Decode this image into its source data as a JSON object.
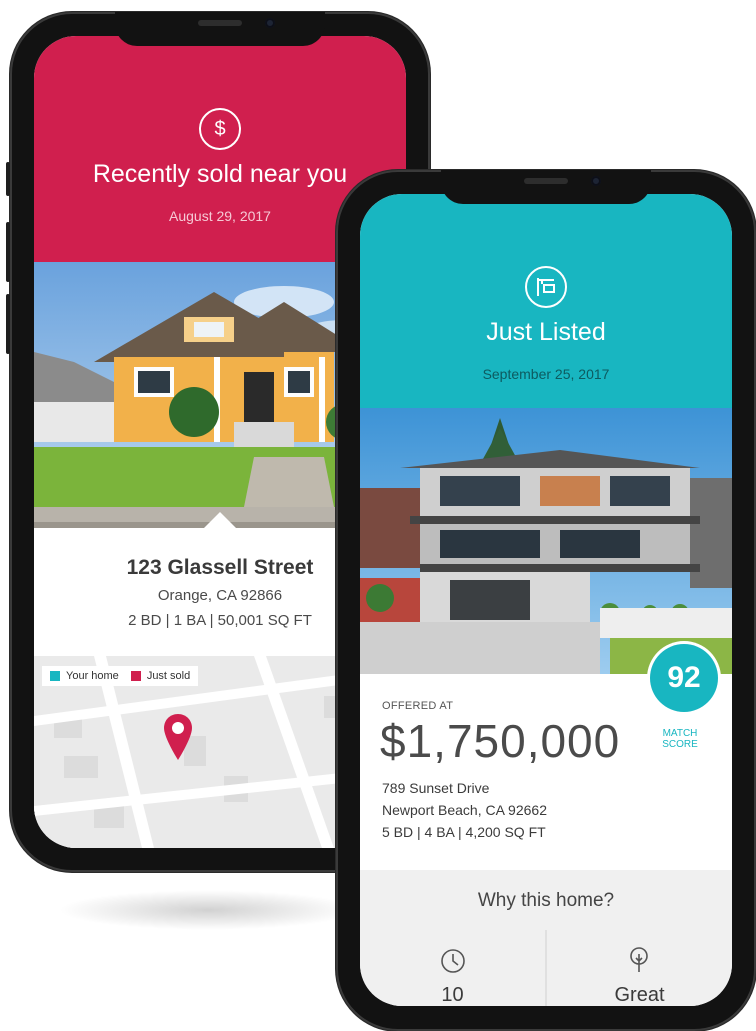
{
  "recently_sold": {
    "icon": "dollar-circle-icon",
    "title": "Recently sold near you",
    "date": "August 29, 2017",
    "address": "123 Glassell Street",
    "city": "Orange, CA 92866",
    "specs": "2 BD | 1 BA | 50,001 SQ FT",
    "legend": {
      "your_home": "Your home",
      "just_sold": "Just sold"
    },
    "colors": {
      "accent": "#d01f4e",
      "your_home": "#18b6c1"
    }
  },
  "just_listed": {
    "icon": "for-sale-sign-icon",
    "title": "Just Listed",
    "date": "September 25, 2017",
    "offered_label": "OFFERED AT",
    "price": "$1,750,000",
    "address": "789 Sunset Drive",
    "city": "Newport Beach, CA 92662",
    "specs": "5 BD | 4 BA | 4,200 SQ FT",
    "match_score": "92",
    "match_label_1": "MATCH",
    "match_label_2": "SCORE",
    "why_title": "Why this home?",
    "stats": [
      {
        "icon": "clock-icon",
        "value": "10"
      },
      {
        "icon": "tree-icon",
        "value": "Great"
      }
    ],
    "colors": {
      "accent": "#18b6c1"
    }
  }
}
